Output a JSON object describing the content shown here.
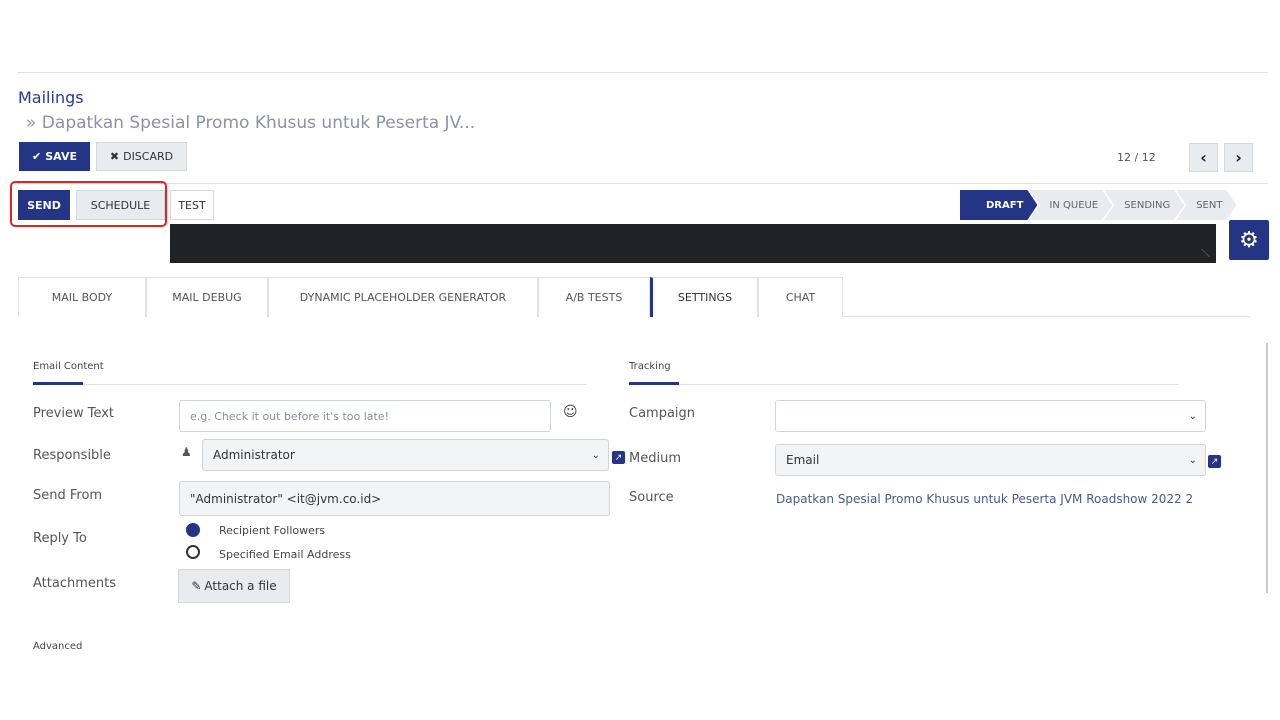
{
  "breadcrumb": {
    "root": "Mailings",
    "current": "» Dapatkan Spesial Promo Khusus untuk Peserta JV..."
  },
  "toolbar": {
    "save_label": "SAVE",
    "discard_label": "DISCARD",
    "pager": "12 / 12"
  },
  "actions": {
    "send": "SEND",
    "schedule": "SCHEDULE",
    "test": "TEST"
  },
  "statusbar": {
    "stages": [
      "DRAFT",
      "IN QUEUE",
      "SENDING",
      "SENT"
    ],
    "active": "DRAFT"
  },
  "tabs": [
    {
      "label": "MAIL BODY"
    },
    {
      "label": "MAIL DEBUG"
    },
    {
      "label": "DYNAMIC PLACEHOLDER GENERATOR"
    },
    {
      "label": "A/B TESTS"
    },
    {
      "label": "SETTINGS",
      "active": true
    },
    {
      "label": "CHAT"
    }
  ],
  "email_content": {
    "section": "Email Content",
    "preview_text_label": "Preview Text",
    "preview_text_placeholder": "e.g. Check it out before it's too late!",
    "responsible_label": "Responsible",
    "responsible_value": "Administrator",
    "send_from_label": "Send From",
    "send_from_value": "\"Administrator\" <it@jvm.co.id>",
    "reply_to_label": "Reply To",
    "reply_to_options": [
      "Recipient Followers",
      "Specified Email Address"
    ],
    "reply_to_selected": "Recipient Followers",
    "attachments_label": "Attachments",
    "attach_button": "Attach a file"
  },
  "tracking": {
    "section": "Tracking",
    "campaign_label": "Campaign",
    "campaign_value": "",
    "medium_label": "Medium",
    "medium_value": "Email",
    "source_label": "Source",
    "source_value": "Dapatkan Spesial Promo Khusus untuk Peserta JVM Roadshow 2022 2"
  },
  "advanced": {
    "section": "Advanced"
  },
  "colors": {
    "primary": "#243585",
    "highlight": "#e02424"
  }
}
